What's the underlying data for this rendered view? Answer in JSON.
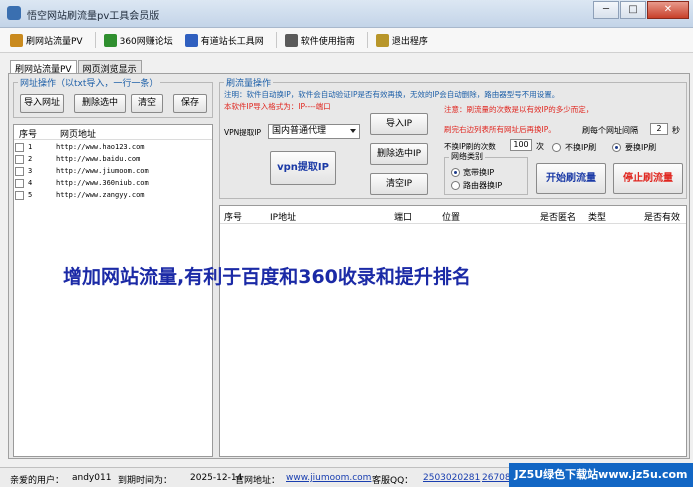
{
  "window": {
    "title": "悟空网站刷流量pv工具会员版",
    "controls": [
      "─",
      "□",
      "✕"
    ]
  },
  "toolbar": {
    "items": [
      {
        "label": "刷网站流量PV",
        "icon": "pen-icon",
        "color": "#c98a1e"
      },
      {
        "label": "360网赚论坛",
        "icon": "forum-icon",
        "color": "#2f8f2f"
      },
      {
        "label": "有道站长工具网",
        "icon": "tools-icon",
        "color": "#2f5fbf"
      },
      {
        "label": "软件使用指南",
        "icon": "guide-icon",
        "color": "#5a5a5a"
      },
      {
        "label": "退出程序",
        "icon": "exit-icon",
        "color": "#b8962a"
      }
    ]
  },
  "tabs": [
    {
      "label": "刷网站流量PV",
      "active": true
    },
    {
      "label": "网页浏览显示",
      "active": false
    }
  ],
  "url_panel": {
    "legend": "网址操作（以txt导入，一行一条）",
    "buttons": {
      "import": "导入网址",
      "delete": "删除选中",
      "clear": "清空",
      "save": "保存"
    },
    "columns": [
      "序号",
      "网页地址"
    ],
    "rows": [
      {
        "index": "1",
        "url": "http://www.hao123.com",
        "checked": false
      },
      {
        "index": "2",
        "url": "http://www.baidu.com",
        "checked": false
      },
      {
        "index": "3",
        "url": "http://www.jiumoom.com",
        "checked": false
      },
      {
        "index": "4",
        "url": "http://www.360niub.com",
        "checked": false
      },
      {
        "index": "5",
        "url": "http://www.zangyy.com",
        "checked": false
      }
    ]
  },
  "traffic_panel": {
    "legend": "刷流量操作",
    "note1": "注明：软件自动换IP，软件会自动验证IP是否有效再换，无效的IP会自动删除，路由器型号不用设置。",
    "note2": "本软件IP导入格式为：IP----端口",
    "note3": "注意：刷流量的次数是以有效IP的多少而定，",
    "note4": "刷完右边列表所有网址后再换IP。",
    "vpn_label": "VPN提取IP",
    "vpn_select": "国内普通代理",
    "vpn_button": "vpn提取IP",
    "import_ip": "导入IP",
    "delete_ip": "删除选中IP",
    "clear_ip": "清空IP",
    "interval_label": "刷每个网址间隔",
    "interval_value": "2",
    "interval_unit": "秒",
    "times_label": "不换IP刷的次数",
    "times_value": "100",
    "times_unit": "次",
    "no_change": "不换IP刷",
    "change": "要换IP刷",
    "network_legend": "网络类别",
    "broadband": "宽带换IP",
    "router": "路由器换IP",
    "start": "开始刷流量",
    "stop": "停止刷流量"
  },
  "ip_table": {
    "columns": [
      "序号",
      "IP地址",
      "端口",
      "位置",
      "是否匿名",
      "类型",
      "是否有效"
    ]
  },
  "promo": "增加网站流量,有利于百度和360收录和提升排名",
  "status": {
    "user_label": "亲爱的用户：",
    "user": "andy011",
    "expire_label": "到期时间为：",
    "expire": "2025-12-14",
    "site_label": "官网地址：",
    "site": "www.jiumoom.com",
    "qq_label": "客服QQ：",
    "qq1": "2503020281",
    "qq2": "26708"
  },
  "watermark": "JZ5U绿色下载站www.jz5u.com"
}
